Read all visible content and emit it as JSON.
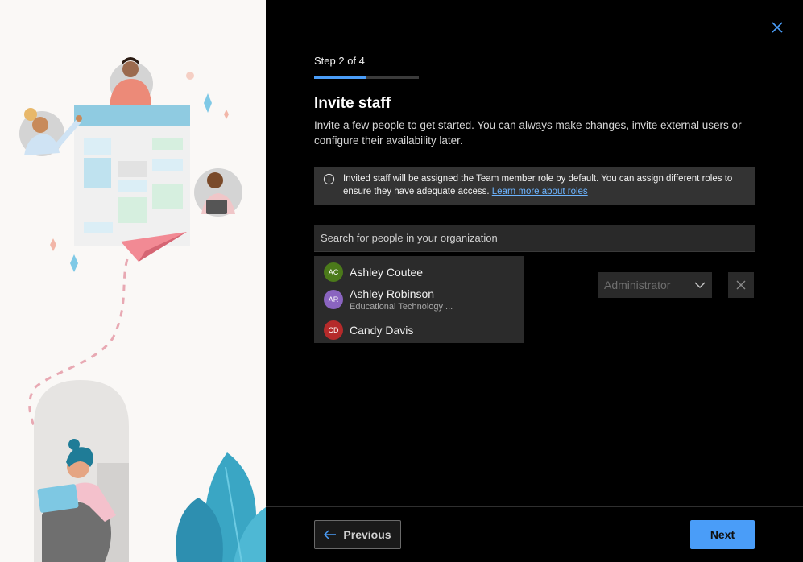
{
  "wizard": {
    "step_label": "Step 2 of 4",
    "progress_fraction": 0.5,
    "title": "Invite staff",
    "description": "Invite a few people to get started. You can always make changes, invite external users or configure their availability later."
  },
  "info_banner": {
    "text": "Invited staff will be assigned the Team member role by default. You can assign different roles to ensure they have adequate access. ",
    "link_text": "Learn more about roles"
  },
  "search": {
    "placeholder": "Search for people in your organization",
    "value": ""
  },
  "suggestions": [
    {
      "initials": "AC",
      "name": "Ashley Coutee",
      "subtitle": "",
      "color": "#4b7a1a"
    },
    {
      "initials": "AR",
      "name": "Ashley Robinson",
      "subtitle": "Educational Technology ...",
      "color": "#8a64c0"
    },
    {
      "initials": "CD",
      "name": "Candy Davis",
      "subtitle": "",
      "color": "#b52a2a"
    }
  ],
  "role_select": {
    "value": "Administrator"
  },
  "footer": {
    "previous_label": "Previous",
    "next_label": "Next"
  },
  "colors": {
    "accent": "#4a9df8",
    "background": "#000000",
    "surface": "#2b2b2b"
  }
}
